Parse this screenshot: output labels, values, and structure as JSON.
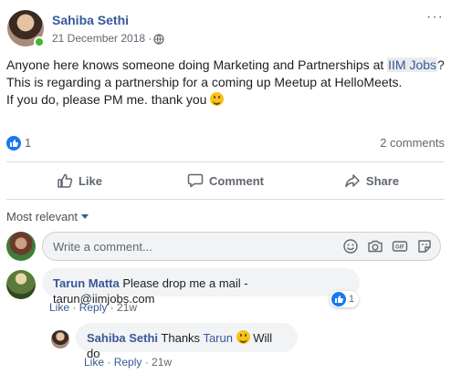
{
  "post": {
    "author": "Sahiba Sethi",
    "date": "21 December 2018 ·",
    "privacy_icon": "globe-icon",
    "text_part1": "Anyone here knows someone doing Marketing and Partnerships at ",
    "tag": "IIM Jobs",
    "text_part2": "? This is regarding a partnership for a coming up Meetup at HelloMeets.",
    "text_line2": "If you do, please PM me. thank you",
    "more_label": "···"
  },
  "reactions": {
    "count": "1",
    "comments": "2 comments"
  },
  "actions": {
    "like": "Like",
    "comment": "Comment",
    "share": "Share"
  },
  "sort": {
    "label": "Most relevant"
  },
  "composer": {
    "placeholder": "Write a comment..."
  },
  "comments": [
    {
      "author": "Tarun Matta",
      "text": "Please drop me a mail - tarun@iimjobs.com",
      "like": "Like",
      "reply": "Reply",
      "age": "21w",
      "reaction_count": "1"
    },
    {
      "author": "Sahiba Sethi",
      "text_before": "Thanks ",
      "mention": "Tarun",
      "text_after": " Will do",
      "like": "Like",
      "reply": "Reply",
      "age": "21w"
    }
  ],
  "colors": {
    "link_blue": "#385898",
    "like_blue": "#1877f2",
    "muted": "#606770",
    "bubble_bg": "#f2f3f5",
    "online_green": "#42b72a"
  }
}
